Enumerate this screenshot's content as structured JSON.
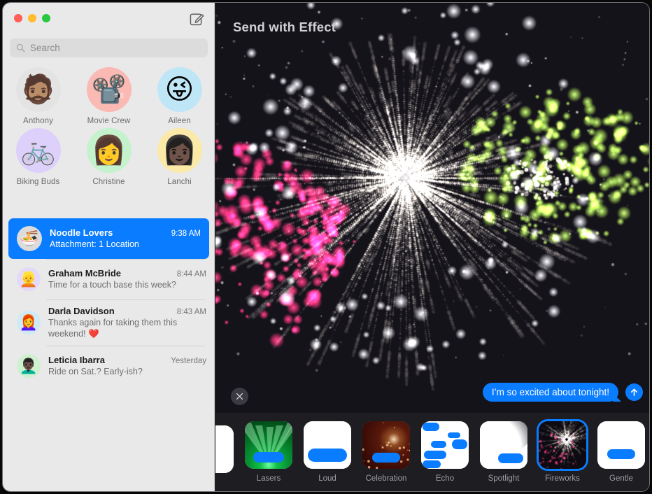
{
  "window": {
    "traffic_lights": [
      {
        "name": "close",
        "color": "#ff5f57"
      },
      {
        "name": "minimize",
        "color": "#febc2e"
      },
      {
        "name": "zoom",
        "color": "#28c840"
      }
    ],
    "compose_label": "New Message"
  },
  "search": {
    "placeholder": "Search",
    "value": ""
  },
  "pinned": [
    {
      "name": "Anthony",
      "emoji": "🧔🏽",
      "bg": "#e3e3e3"
    },
    {
      "name": "Movie Crew",
      "emoji": "📽️",
      "bg": "#fab9b3"
    },
    {
      "name": "Aileen",
      "emoji": "😜",
      "bg": "#bfe6f7"
    },
    {
      "name": "Biking Buds",
      "emoji": "🚲",
      "bg": "#ddd0fb"
    },
    {
      "name": "Christine",
      "emoji": "👩",
      "bg": "#c3f2cc"
    },
    {
      "name": "Lanchi",
      "emoji": "👩🏿",
      "bg": "#fbe9a8"
    }
  ],
  "conversations": [
    {
      "name": "Noodle Lovers",
      "time": "9:38 AM",
      "preview": "Attachment: 1 Location",
      "emoji": "🍜",
      "bg": "#dcdcdc",
      "selected": true
    },
    {
      "name": "Graham McBride",
      "time": "8:44 AM",
      "preview": "Time for a touch base this week?",
      "emoji": "👱",
      "bg": "#e5d9fb",
      "selected": false
    },
    {
      "name": "Darla Davidson",
      "time": "8:43 AM",
      "preview": "Thanks again for taking them this weekend! ❤️",
      "emoji": "👩‍🦰",
      "bg": "#cfeaf7",
      "selected": false
    },
    {
      "name": "Leticia Ibarra",
      "time": "Yesterday",
      "preview": "Ride on Sat.? Early-ish?",
      "emoji": "👨🏿‍🦱",
      "bg": "#cdf0cf",
      "selected": false
    }
  ],
  "stage": {
    "title": "Send with Effect",
    "close_label": "Cancel effect",
    "send_label": "Send",
    "message_text": "I’m so excited about tonight!",
    "accent": "#0a7cff",
    "background": "#15131a",
    "firework_colors": [
      "#fff6e6",
      "#f2246c",
      "#b6e84a"
    ]
  },
  "effects": [
    {
      "label": "",
      "style": "bubbles",
      "selected": false,
      "clipped": true
    },
    {
      "label": "Lasers",
      "style": "lasers",
      "selected": false,
      "clipped": false
    },
    {
      "label": "Loud",
      "style": "loud",
      "selected": false,
      "clipped": false
    },
    {
      "label": "Celebration",
      "style": "celebration",
      "selected": false,
      "clipped": false
    },
    {
      "label": "Echo",
      "style": "echo",
      "selected": false,
      "clipped": false
    },
    {
      "label": "Spotlight",
      "style": "spotlight",
      "selected": false,
      "clipped": false
    },
    {
      "label": "Fireworks",
      "style": "fireworks",
      "selected": true,
      "clipped": false
    },
    {
      "label": "Gentle",
      "style": "gentle",
      "selected": false,
      "clipped": false
    }
  ]
}
